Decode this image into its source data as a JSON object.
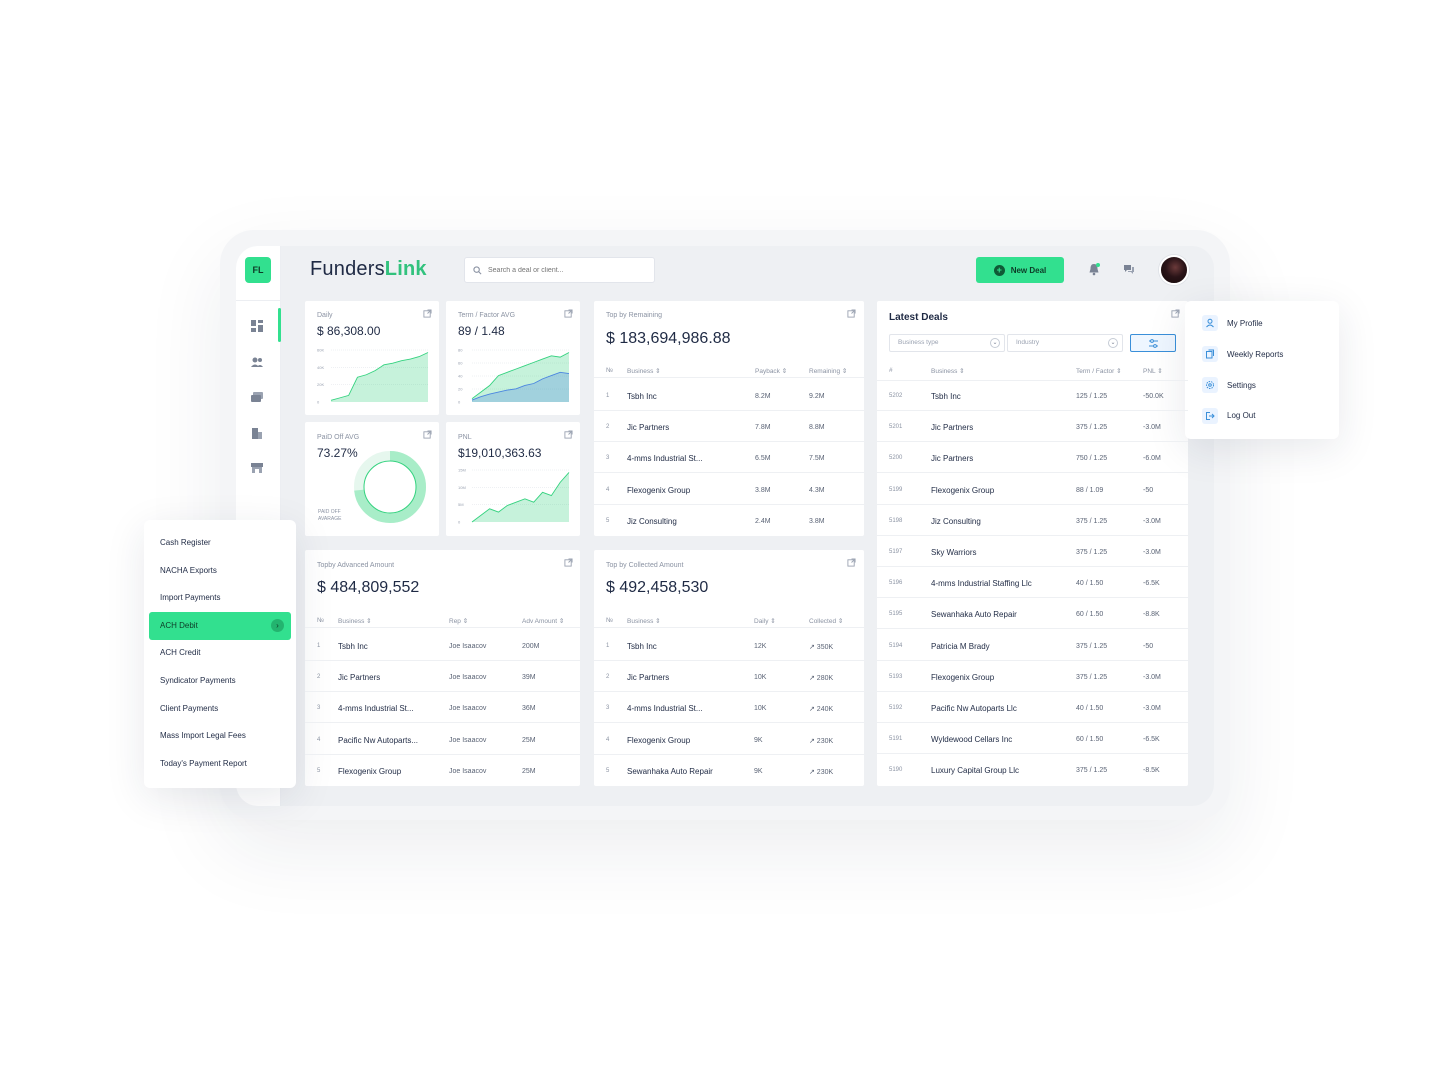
{
  "brand": {
    "badge": "FL",
    "name_a": "Funders",
    "name_b": "Link"
  },
  "search": {
    "placeholder": "Search a deal or client..."
  },
  "header": {
    "new_deal_label": "New Deal"
  },
  "kpis": {
    "daily": {
      "label": "Daily",
      "value": "$ 86,308.00",
      "ticks": [
        "60K",
        "40K",
        "20K",
        "0"
      ]
    },
    "term": {
      "label": "Term / Factor AVG",
      "value": "89 / 1.48",
      "ticks": [
        "80",
        "60",
        "40",
        "20",
        "0"
      ]
    },
    "paid": {
      "label": "PaiD Off AVG",
      "value": "73.27%",
      "caption_1": "PAID OFF",
      "caption_2": "AVARAGE",
      "percent": 73.27
    },
    "pnl": {
      "label": "PNL",
      "value": "$19,010,363.63",
      "ticks": [
        "15M",
        "10M",
        "5M",
        "0"
      ]
    }
  },
  "top_remaining": {
    "label": "Top by Remaining",
    "value": "$ 183,694,986.88",
    "headers": [
      "№",
      "Business ⇕",
      "Payback ⇕",
      "Remaining ⇕"
    ],
    "rows": [
      {
        "n": "1",
        "business": "Tsbh Inc",
        "a": "8.2M",
        "b": "9.2M"
      },
      {
        "n": "2",
        "business": "Jic Partners",
        "a": "7.8M",
        "b": "8.8M"
      },
      {
        "n": "3",
        "business": "4-mms Industrial St...",
        "a": "6.5M",
        "b": "7.5M"
      },
      {
        "n": "4",
        "business": "Flexogenix Group",
        "a": "3.8M",
        "b": "4.3M"
      },
      {
        "n": "5",
        "business": "Jiz Consulting",
        "a": "2.4M",
        "b": "3.8M"
      }
    ]
  },
  "top_advanced": {
    "label": "Topby Advanced Amount",
    "value": "$ 484,809,552",
    "headers": [
      "№",
      "Business ⇕",
      "Rep ⇕",
      "Adv Amount ⇕"
    ],
    "rows": [
      {
        "n": "1",
        "business": "Tsbh Inc",
        "a": "Joe Isaacov",
        "b": "200M"
      },
      {
        "n": "2",
        "business": "Jic Partners",
        "a": "Joe Isaacov",
        "b": "39M"
      },
      {
        "n": "3",
        "business": "4-mms Industrial St...",
        "a": "Joe Isaacov",
        "b": "36M"
      },
      {
        "n": "4",
        "business": "Pacific Nw Autoparts...",
        "a": "Joe Isaacov",
        "b": "25M"
      },
      {
        "n": "5",
        "business": "Flexogenix Group",
        "a": "Joe Isaacov",
        "b": "25M"
      }
    ]
  },
  "top_collected": {
    "label": "Top by Collected Amount",
    "value": "$ 492,458,530",
    "headers": [
      "№",
      "Business ⇕",
      "Daily ⇕",
      "Collected ⇕"
    ],
    "rows": [
      {
        "n": "1",
        "business": "Tsbh Inc",
        "a": "12K",
        "b": "↗  350K"
      },
      {
        "n": "2",
        "business": "Jic Partners",
        "a": "10K",
        "b": "↗  280K"
      },
      {
        "n": "3",
        "business": "4-mms Industrial St...",
        "a": "10K",
        "b": "↗  240K"
      },
      {
        "n": "4",
        "business": "Flexogenix Group",
        "a": "9K",
        "b": "↗  230K"
      },
      {
        "n": "5",
        "business": "Sewanhaka Auto Repair",
        "a": "9K",
        "b": "↗  230K"
      }
    ]
  },
  "latest_deals": {
    "title": "Latest Deals",
    "filter_1": "Business type",
    "filter_2": "Industry",
    "headers": [
      "#",
      "Business ⇕",
      "Term / Factor ⇕",
      "PNL ⇕"
    ],
    "rows": [
      {
        "id": "5202",
        "business": "Tsbh Inc",
        "term": "125 / 1.25",
        "pnl": "-50.0K"
      },
      {
        "id": "5201",
        "business": "Jic Partners",
        "term": "375 / 1.25",
        "pnl": "-3.0M"
      },
      {
        "id": "5200",
        "business": "Jic Partners",
        "term": "750 / 1.25",
        "pnl": "-6.0M"
      },
      {
        "id": "5199",
        "business": "Flexogenix Group",
        "term": "88 / 1.09",
        "pnl": "-50"
      },
      {
        "id": "5198",
        "business": "Jiz Consulting",
        "term": "375 / 1.25",
        "pnl": "-3.0M"
      },
      {
        "id": "5197",
        "business": "Sky Warriors",
        "term": "375 / 1.25",
        "pnl": "-3.0M"
      },
      {
        "id": "5196",
        "business": "4-mms Industrial Staffing Llc",
        "term": "40 / 1.50",
        "pnl": "-6.5K"
      },
      {
        "id": "5195",
        "business": "Sewanhaka Auto Repair",
        "term": "60 / 1.50",
        "pnl": "-8.8K"
      },
      {
        "id": "5194",
        "business": "Patricia M Brady",
        "term": "375 / 1.25",
        "pnl": "-50"
      },
      {
        "id": "5193",
        "business": "Flexogenix Group",
        "term": "375 / 1.25",
        "pnl": "-3.0M"
      },
      {
        "id": "5192",
        "business": "Pacific Nw Autoparts Llc",
        "term": "40 / 1.50",
        "pnl": "-3.0M"
      },
      {
        "id": "5191",
        "business": "Wyldewood Cellars Inc",
        "term": "60 / 1.50",
        "pnl": "-6.5K"
      },
      {
        "id": "5190",
        "business": "Luxury Capital Group Llc",
        "term": "375 / 1.25",
        "pnl": "-8.5K"
      }
    ]
  },
  "left_menu": {
    "items": [
      "Cash Register",
      "NACHA Exports",
      "Import Payments",
      "ACH Debit",
      "ACH Credit",
      "Syndicator Payments",
      "Client Payments",
      "Mass Import Legal Fees",
      "Today's Payment Report"
    ],
    "active": "ACH Debit"
  },
  "profile_menu": {
    "items": [
      "My Profile",
      "Weekly Reports",
      "Settings",
      "Log Out"
    ]
  },
  "colors": {
    "accent": "#32e08f",
    "positive": "#2fbf79",
    "link": "#3a8fd9",
    "text": "#1f2a44"
  },
  "chart_data": [
    {
      "type": "area",
      "title": "Daily",
      "series": [
        {
          "values": [
            2,
            5,
            8,
            30,
            33,
            38,
            45,
            47,
            50,
            52,
            55,
            60
          ]
        }
      ],
      "ylim": [
        0,
        60000
      ]
    },
    {
      "type": "area",
      "title": "Term / Factor AVG",
      "series": [
        {
          "values": [
            5,
            15,
            25,
            40,
            45,
            50,
            55,
            60,
            65,
            70,
            68,
            75
          ]
        },
        {
          "values": [
            3,
            8,
            12,
            15,
            18,
            20,
            25,
            28,
            35,
            40,
            45,
            43
          ]
        }
      ],
      "ylim": [
        0,
        80
      ]
    },
    {
      "type": "area",
      "title": "PNL",
      "series": [
        {
          "values": [
            0,
            2,
            4,
            3,
            5,
            6,
            7,
            6,
            9,
            8,
            12,
            15
          ]
        }
      ],
      "ylim": [
        0,
        15000000
      ]
    }
  ]
}
